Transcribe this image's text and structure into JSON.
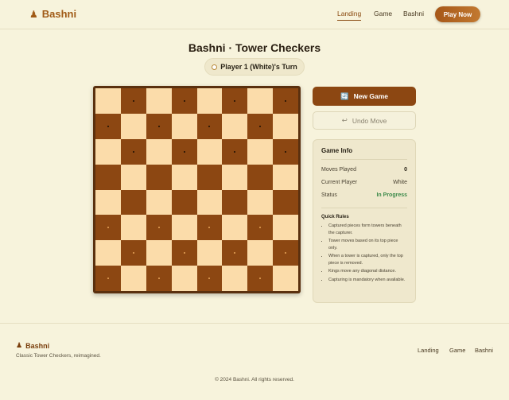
{
  "header": {
    "brand": "Bashni",
    "nav": [
      "Landing",
      "Game",
      "Bashni"
    ],
    "cta": "Play Now"
  },
  "game": {
    "title": "Bashni · Tower Checkers",
    "turn": "Player 1 (White)'s Turn",
    "board": {
      "size": 8,
      "black_pieces_rows": [
        0,
        1,
        2
      ],
      "white_pieces_rows": [
        5,
        6,
        7
      ]
    }
  },
  "controls": {
    "new_game": "New Game",
    "undo": "Undo Move"
  },
  "info": {
    "title": "Game Info",
    "moves_label": "Moves Played",
    "moves_value": "0",
    "player_label": "Current Player",
    "player_value": "White",
    "status_label": "Status",
    "status_value": "In Progress",
    "rules_title": "Quick Rules",
    "rules": [
      "Captured pieces form towers beneath the capturer.",
      "Tower moves based on its top piece only.",
      "When a tower is captured, only the top piece is removed.",
      "Kings move any diagonal distance.",
      "Capturing is mandatory when available."
    ]
  },
  "footer": {
    "brand": "Bashni",
    "tagline": "Classic Tower Checkers, reimagined.",
    "nav": [
      "Landing",
      "Game",
      "Bashni"
    ],
    "copyright": "© 2024 Bashni. All rights reserved."
  },
  "colors": {
    "accent": "#8c4712",
    "light_square": "#fbdcaa",
    "dark_square": "#8c4712",
    "background": "#f7f3dc",
    "status_green": "#3c8a4a"
  }
}
